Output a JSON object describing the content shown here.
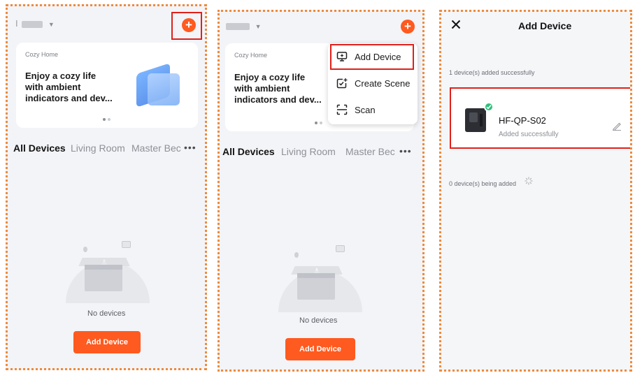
{
  "accent_color": "#ff5a1f",
  "highlight_color": "#e0201a",
  "screen1": {
    "home_name": "I",
    "plus_icon": "plus-circle-icon",
    "banner": {
      "label": "Cozy Home",
      "title": "Enjoy a cozy life\nwith ambient\nindicators and dev..."
    },
    "tabs": [
      "All Devices",
      "Living Room",
      "Master Bec"
    ],
    "more": "•••",
    "empty_text": "No devices",
    "add_button": "Add Device"
  },
  "screen2": {
    "banner": {
      "label": "Cozy Home",
      "title": "Enjoy a cozy life\nwith ambient\nindicators and dev..."
    },
    "menu": [
      {
        "icon": "add-device-icon",
        "label": "Add Device"
      },
      {
        "icon": "create-scene-icon",
        "label": "Create Scene"
      },
      {
        "icon": "scan-icon",
        "label": "Scan"
      }
    ],
    "tabs": [
      "All Devices",
      "Living Room",
      "Master Bec"
    ],
    "more": "•••",
    "empty_text": "No devices",
    "add_button": "Add Device"
  },
  "screen3": {
    "title": "Add Device",
    "close_icon": "close-icon",
    "added_status": "1 device(s) added successfully",
    "device": {
      "name": "HF-QP-S02",
      "status": "Added successfully"
    },
    "adding_status": "0 device(s) being added"
  }
}
